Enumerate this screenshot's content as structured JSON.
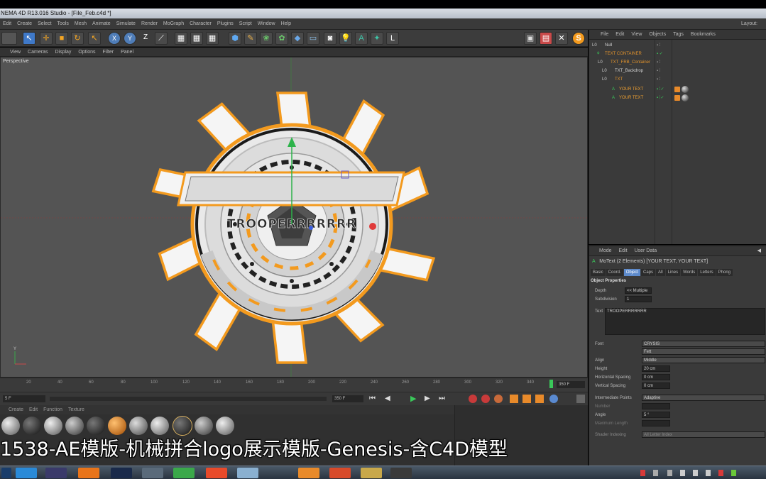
{
  "window": {
    "title": "NEMA 4D R13.016 Studio - [File_Feb.c4d *]",
    "layout_label": "Layout:"
  },
  "main_menu": [
    "Edit",
    "Create",
    "Select",
    "Tools",
    "Mesh",
    "Animate",
    "Simulate",
    "Render",
    "MoGraph",
    "Character",
    "Plugins",
    "Script",
    "Window",
    "Help"
  ],
  "viewport": {
    "menu": [
      "View",
      "Cameras",
      "Display",
      "Options",
      "Filter",
      "Panel"
    ],
    "label": "Perspective",
    "logo_text": "TROOPERRRRRRR"
  },
  "timeline": {
    "ticks": [
      "20",
      "40",
      "60",
      "80",
      "100",
      "120",
      "140",
      "160",
      "180",
      "200",
      "220",
      "240",
      "260",
      "280",
      "300",
      "320",
      "340"
    ],
    "end_frame": "350 F",
    "start_frame": "5 F",
    "max_frame": "350 F"
  },
  "material_manager": {
    "menu": [
      "Create",
      "Edit",
      "Function",
      "Texture"
    ]
  },
  "object_manager": {
    "menu": [
      "File",
      "Edit",
      "View",
      "Objects",
      "Tags",
      "Bookmarks"
    ],
    "rows": [
      {
        "name": "Null",
        "color": "#cfcfcf"
      },
      {
        "name": "TEXT CONTAINER",
        "color": "#e0922c"
      },
      {
        "name": "TXT_FRB_Container",
        "color": "#e0922c"
      },
      {
        "name": "TXT_Backdrop",
        "color": "#cfcfcf"
      },
      {
        "name": "TXT",
        "color": "#e0922c"
      },
      {
        "name": "YOUR TEXT",
        "color": "#f0a030"
      },
      {
        "name": "YOUR TEXT",
        "color": "#f0a030"
      }
    ]
  },
  "attribute_manager": {
    "menu": [
      "Mode",
      "Edit",
      "User Data"
    ],
    "header": "MoText (2 Elements) [YOUR TEXT, YOUR TEXT]",
    "tabs": [
      "Basic",
      "Coord.",
      "Object",
      "Caps",
      "All",
      "Lines",
      "Words",
      "Letters",
      "Phong"
    ],
    "active_tab": "Object",
    "section": "Object Properties",
    "depth_label": "Depth",
    "depth_value": "<< Multiple",
    "subdivision_label": "Subdivision",
    "subdivision_value": "1",
    "text_label": "Text",
    "text_value": "TROOPERRRRRRR",
    "font_label": "Font",
    "font_name": "CRYSIS",
    "font_style": "Fett",
    "align_label": "Align",
    "align_value": "Middle",
    "height_label": "Height",
    "height_value": "20 cm",
    "hspacing_label": "Horizontal Spacing",
    "hspacing_value": "0 cm",
    "vspacing_label": "Vertical Spacing",
    "vspacing_value": "0 cm",
    "interp_label": "Intermediate Points",
    "interp_value": "Adaptive",
    "number_label": "Number",
    "angle_label": "Angle",
    "angle_value": "5 °",
    "maxlen_label": "Maximum Length",
    "shader_label": "Shader Indexing",
    "shader_value": "All Letter Index"
  },
  "caption": "1538-AE模版-机械拼合logo展示模版-Genesis-含C4D模型",
  "colors": {
    "accent_orange": "#f39a1e",
    "selection_blue": "#5d8acb",
    "viewport_bg": "#545454"
  }
}
